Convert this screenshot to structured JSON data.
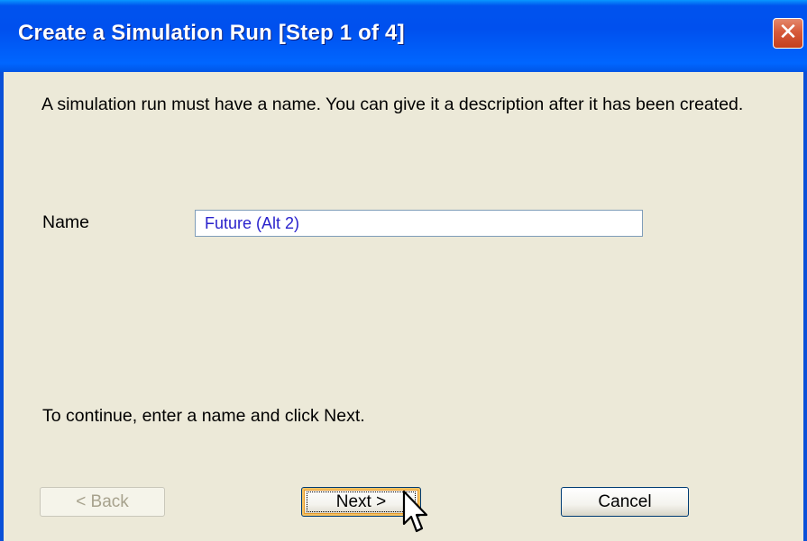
{
  "window": {
    "title": "Create a Simulation Run [Step 1 of 4]",
    "close_glyph": "✕",
    "close_icon": "close-icon"
  },
  "content": {
    "instruction": "A simulation run must have a name. You can give it a description after it has been created.",
    "name_label": "Name",
    "name_value": "Future (Alt 2)",
    "continue_hint": "To continue, enter a name and click Next."
  },
  "buttons": {
    "back_label": "< Back",
    "back_enabled": false,
    "next_label": "Next >",
    "cancel_label": "Cancel"
  },
  "colors": {
    "title_bar": "#0053ee",
    "dialog_bg": "#ece9d8",
    "input_text": "#2a22cc",
    "close_button": "#d65a3a"
  }
}
